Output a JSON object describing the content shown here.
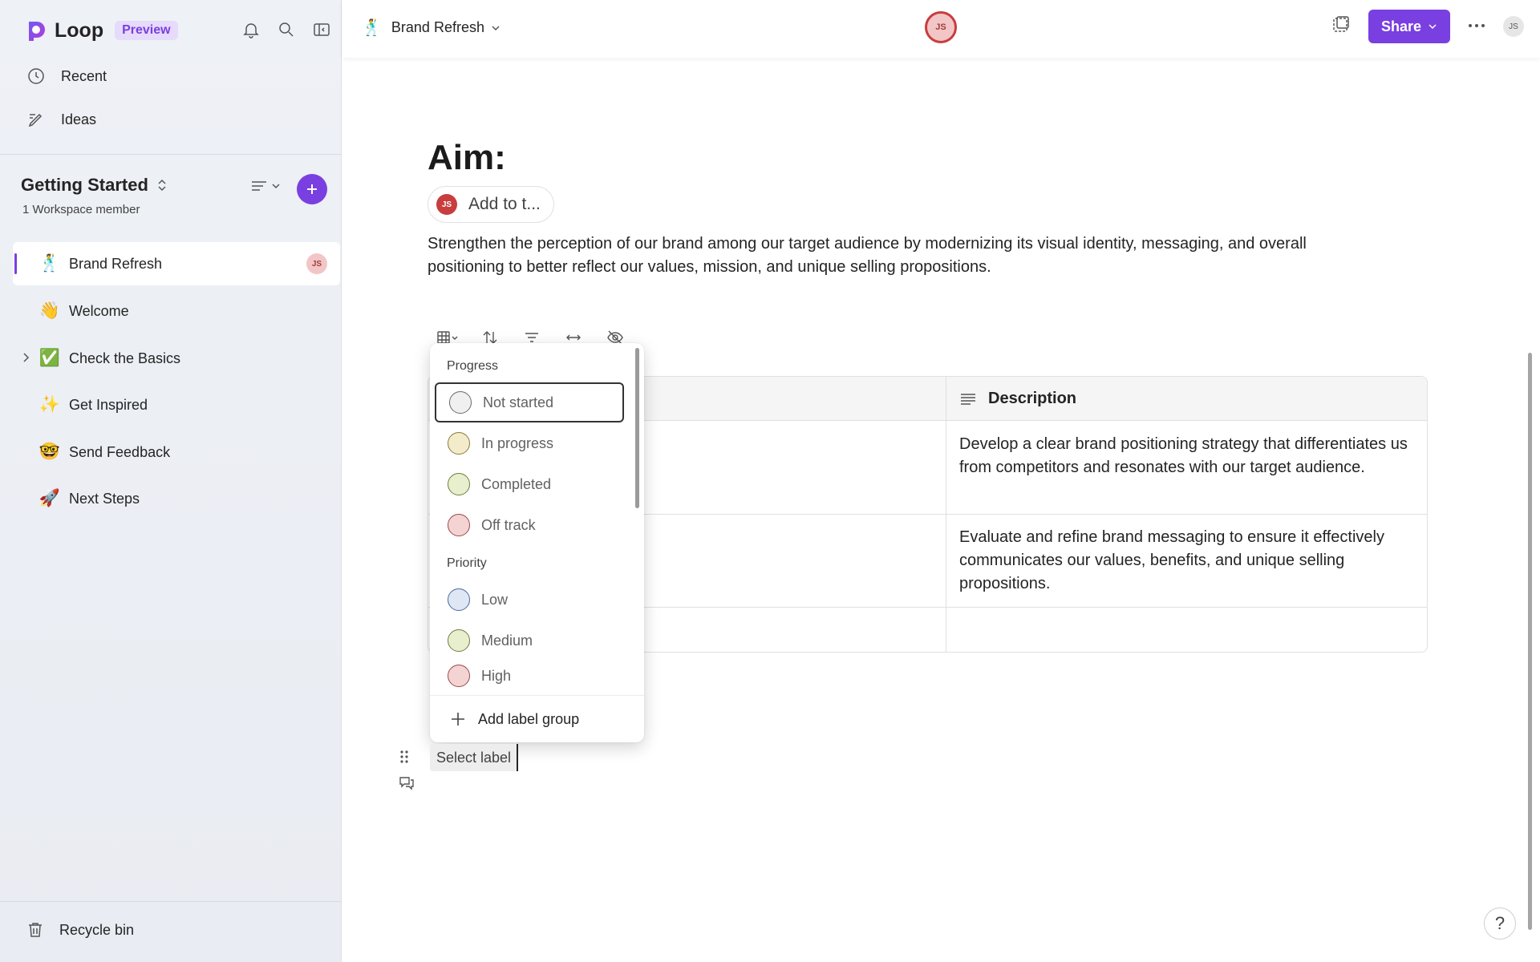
{
  "app": {
    "name": "Loop",
    "badge": "Preview"
  },
  "sidebar": {
    "nav": [
      {
        "label": "Recent",
        "icon": "clock-icon"
      },
      {
        "label": "Ideas",
        "icon": "pen-icon"
      }
    ],
    "workspace": {
      "title": "Getting Started",
      "subtitle": "1 Workspace member"
    },
    "pages": [
      {
        "emoji": "🕺",
        "label": "Brand Refresh",
        "active": true,
        "avatar": "JS"
      },
      {
        "emoji": "👋",
        "label": "Welcome"
      },
      {
        "emoji": "✅",
        "label": "Check the Basics",
        "expandable": true
      },
      {
        "emoji": "✨",
        "label": "Get Inspired"
      },
      {
        "emoji": "🤓",
        "label": "Send Feedback"
      },
      {
        "emoji": "🚀",
        "label": "Next Steps"
      }
    ],
    "recycle": "Recycle bin"
  },
  "header": {
    "doc_emoji": "🕺",
    "doc_title": "Brand Refresh",
    "presence_initials": "JS",
    "share_label": "Share",
    "user_initials": "JS"
  },
  "doc": {
    "heading": "Aim:",
    "assign_initials": "JS",
    "assign_label": "Add to t...",
    "paragraph": "Strengthen the perception of our brand among our target audience by modernizing its visual identity, messaging, and overall positioning to better reflect our values, mission, and unique selling propositions.",
    "table": {
      "header_description": "Description",
      "rows": [
        "Develop a clear brand positioning strategy that differentiates us from competitors and resonates with our target audience.",
        "Evaluate and refine brand messaging to ensure it effectively communicates our values, benefits, and unique selling propositions.",
        ""
      ]
    },
    "select_label": "Select label"
  },
  "dropdown": {
    "groups": [
      {
        "title": "Progress",
        "options": [
          {
            "label": "Not started",
            "color": "#f0f0f0",
            "border": "#6b6b6b"
          },
          {
            "label": "In progress",
            "color": "#f3eccb",
            "border": "#8a7a3a"
          },
          {
            "label": "Completed",
            "color": "#e7efcf",
            "border": "#6f7f3a"
          },
          {
            "label": "Off track",
            "color": "#f4d3d3",
            "border": "#9a4a4a"
          }
        ]
      },
      {
        "title": "Priority",
        "options": [
          {
            "label": "Low",
            "color": "#dfe7f5",
            "border": "#4a6a9a"
          },
          {
            "label": "Medium",
            "color": "#e7efcf",
            "border": "#6f7f3a"
          },
          {
            "label": "High",
            "color": "#f4d3d3",
            "border": "#9a4a4a"
          }
        ]
      }
    ],
    "add_label": "Add label group"
  },
  "colors": {
    "accent": "#7a3fe0"
  },
  "help": "?"
}
